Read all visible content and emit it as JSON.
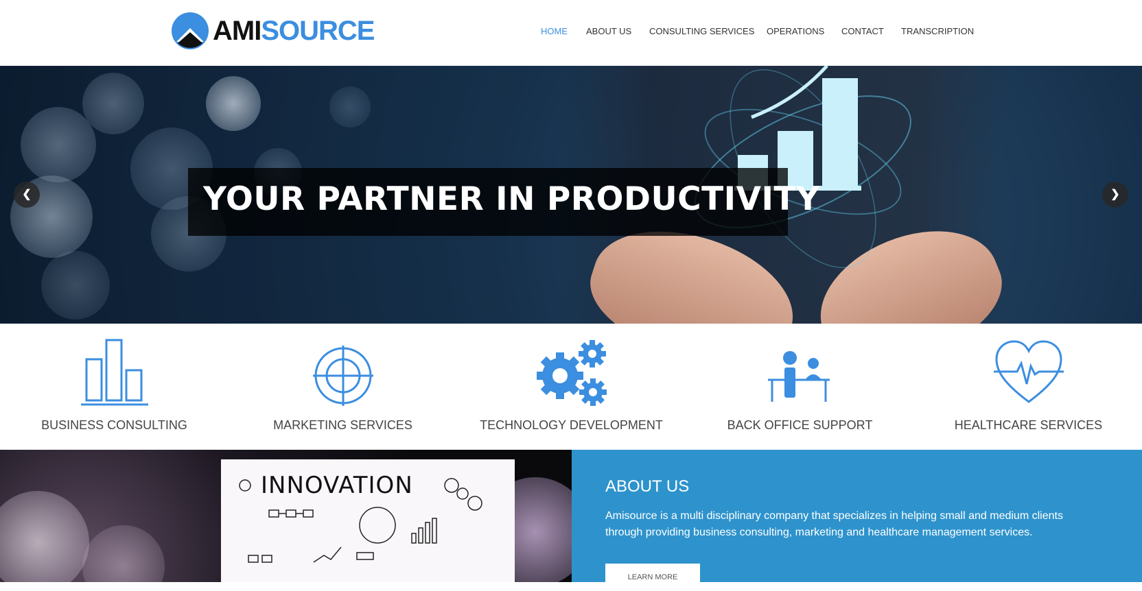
{
  "header": {
    "logo": {
      "part1": "AMI",
      "part2": "SOURCE"
    },
    "nav": [
      {
        "label": "HOME",
        "active": true
      },
      {
        "label": "ABOUT US",
        "active": false
      },
      {
        "label": "CONSULTING SERVICES",
        "active": false
      },
      {
        "label": "OPERATIONS",
        "active": false
      },
      {
        "label": "CONTACT",
        "active": false
      },
      {
        "label": "TRANSCRIPTION",
        "active": false
      }
    ]
  },
  "hero": {
    "caption": "YOUR PARTNER IN PRODUCTIVITY",
    "prev_icon": "chevron-left-icon",
    "next_icon": "chevron-right-icon"
  },
  "services": [
    {
      "label": "BUSINESS CONSULTING",
      "icon": "bar-chart-icon"
    },
    {
      "label": "MARKETING SERVICES",
      "icon": "target-icon"
    },
    {
      "label": "TECHNOLOGY DEVELOPMENT",
      "icon": "gears-icon"
    },
    {
      "label": "BACK OFFICE SUPPORT",
      "icon": "office-people-icon"
    },
    {
      "label": "HEALTHCARE SERVICES",
      "icon": "heart-pulse-icon"
    }
  ],
  "about": {
    "title": "ABOUT US",
    "text": "Amisource is a multi disciplinary company that specializes in helping small and medium clients through providing business consulting, marketing  and healthcare management services.",
    "button": "LEARN MORE",
    "image_text": "INNOVATION"
  },
  "colors": {
    "accent": "#3b8ee0",
    "about_bg": "#2e93cc"
  }
}
